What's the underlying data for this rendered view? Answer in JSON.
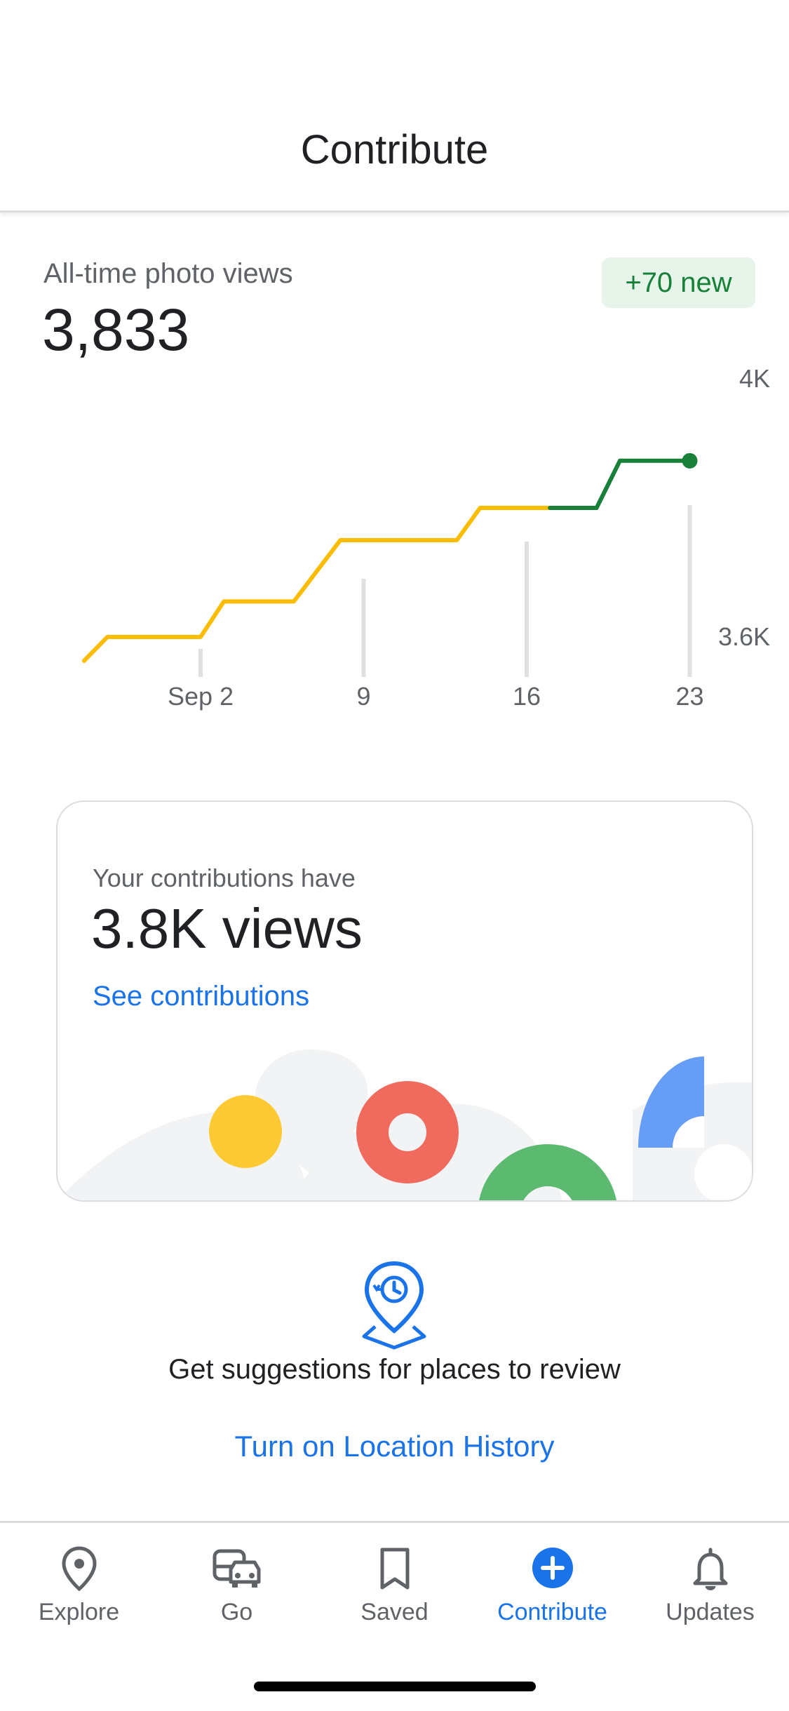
{
  "header": {
    "title": "Contribute"
  },
  "stats": {
    "label": "All-time photo views",
    "value": "3,833",
    "badge": "+70 new"
  },
  "chart_data": {
    "type": "line",
    "x": [
      "Aug 28",
      "Aug 29",
      "Sep 2",
      "Sep 3",
      "Sep 6",
      "Sep 8",
      "Sep 9",
      "Sep 13",
      "Sep 14",
      "Sep 17",
      "Sep 19",
      "Sep 20",
      "Sep 22",
      "Sep 23"
    ],
    "values": [
      3563,
      3600,
      3600,
      3655,
      3655,
      3750,
      3750,
      3750,
      3800,
      3800,
      3800,
      3873,
      3873,
      3873
    ],
    "x_ticks": [
      "Sep 2",
      "9",
      "16",
      "23"
    ],
    "y_ticks": [
      "4K",
      "3.6K"
    ],
    "ylim": [
      3500,
      4000
    ],
    "colors": {
      "earlier": "#fbbc04",
      "recent": "#188038"
    },
    "recent_from_index": 9,
    "grid": false
  },
  "card": {
    "subtitle": "Your contributions have",
    "value": "3.8K views",
    "link": "See contributions"
  },
  "suggestion": {
    "text": "Get suggestions for places to review",
    "link": "Turn on Location History",
    "icon": "location-history-icon"
  },
  "tabs": [
    {
      "label": "Explore",
      "icon": "location-pin-icon",
      "active": false
    },
    {
      "label": "Go",
      "icon": "commute-icon",
      "active": false
    },
    {
      "label": "Saved",
      "icon": "bookmark-icon",
      "active": false
    },
    {
      "label": "Contribute",
      "icon": "add-circle-icon",
      "active": true
    },
    {
      "label": "Updates",
      "icon": "bell-icon",
      "active": false
    }
  ],
  "colors": {
    "accent": "#1a73e8",
    "positive": "#188038",
    "badge_bg": "#e6f4ea"
  }
}
